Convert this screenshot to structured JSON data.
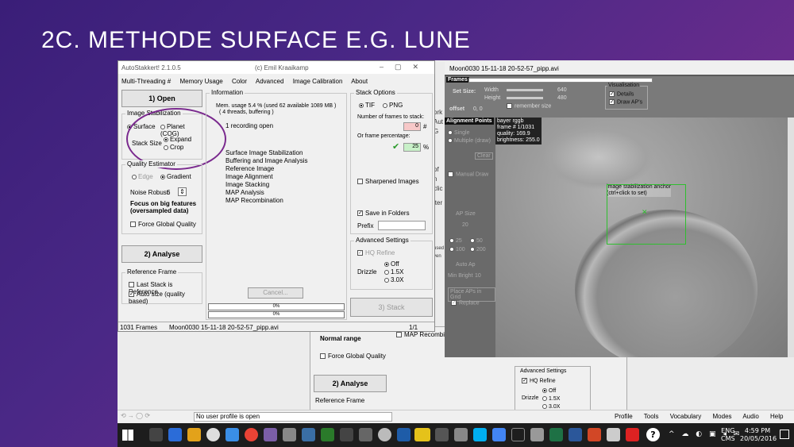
{
  "slide": {
    "title": "2C. METHODE SURFACE E.G. LUNE"
  },
  "main_window": {
    "title": "AutoStakkert! 2.1.0.5",
    "author": "(c) Emil Kraaikamp",
    "menu": [
      "Multi-Threading #",
      "Memory Usage",
      "Color",
      "Advanced",
      "Image Calibration",
      "About"
    ],
    "open_button": "1) Open",
    "image_stabilization": {
      "label": "Image Stabilization",
      "surface": "Surface",
      "planet": "Planet (COG)",
      "stack_size": "Stack Size",
      "expand": "Expand",
      "crop": "Crop"
    },
    "quality_estimator": {
      "label": "Quality Estimator",
      "edge": "Edge",
      "gradient": "Gradient",
      "noise_robust": "Noise Robust",
      "noise_value": "6",
      "focus_text": "Focus on big features (oversampled data)",
      "force_global": "Force Global Quality"
    },
    "analyse_button": "2) Analyse",
    "reference_frame": {
      "label": "Reference Frame",
      "last_stack": "Last Stack is Reference",
      "auto_size": "Auto size (quality based)"
    },
    "information": {
      "label": "Information",
      "mem_line1": "Mem. usage 5.4 %  (used 62 available 1089 MB )",
      "mem_line2": "( 4 threads, buffering )",
      "status": "1 recording open",
      "steps": [
        "Surface Image Stabilization",
        "Buffering and Image Analysis",
        "Reference Image",
        "Image Alignment",
        "Image Stacking",
        "MAP Analysis",
        "MAP Recombination"
      ]
    },
    "cancel_button": "Cancel...",
    "progress1": "0%",
    "progress2": "0%",
    "stack_options": {
      "label": "Stack Options",
      "tif": "TIF",
      "png": "PNG",
      "num_frames_label": "Number of frames to stack:",
      "num_frames_value": "0",
      "hash": "#",
      "percentage_label": "Or frame percentage:",
      "percentage_value": "25",
      "percent": "%",
      "sharpened": "Sharpened Images",
      "save_folders": "Save in Folders",
      "prefix": "Prefix"
    },
    "advanced": {
      "label": "Advanced Settings",
      "hq_refine": "HQ Refine",
      "drizzle": "Drizzle",
      "off": "Off",
      "d15": "1.5X",
      "d30": "3.0X"
    },
    "stack_button": "3) Stack",
    "status_bar": {
      "frames": "1031 Frames",
      "file": "Moon0030 15-11-18 20-52-57_pipp.avi",
      "page": "1/1"
    }
  },
  "preview_window": {
    "title": "Moon0030 15-11-18 20-52-57_pipp.avi",
    "frames_label": "Frames",
    "set_size": "Set Size:",
    "width_label": "Width",
    "width_value": "640",
    "height_label": "Height",
    "height_value": "480",
    "remember": "remember size",
    "offset": "offset",
    "offset_value": "0, 0",
    "visualisation": {
      "label": "Visualisation",
      "details": "Details",
      "draw_aps": "Draw AP's"
    },
    "alignment_points": "Alignment Points",
    "info_overlay": [
      "bayer rggb",
      "frame # 1/1031",
      "quality: 169.9",
      "brightness: 255.0"
    ],
    "anchor_text": "image stabilization anchor",
    "anchor_hint": "(ctrl+click to set)",
    "side_labels": {
      "single": "Single",
      "multiple": "Multiple (draw)",
      "clear": "Clear",
      "manual": "Manual Draw",
      "ap_size": "AP Size",
      "ap_size_val": "20",
      "s25": "25",
      "s50": "50",
      "s100": "100",
      "s200": "200",
      "auto_ap": "Auto Ap",
      "min_bright": "Min Bright",
      "min_bright_val": "10",
      "place_grid": "Place APs in Grid",
      "replace": "Replace"
    }
  },
  "back_window": {
    "normal_range": "Normal range",
    "force_global": "Force Global Quality",
    "analyse": "2) Analyse",
    "ref_frame": "Reference Frame",
    "map_recomb": "MAP Recombinat",
    "advanced": "Advanced Settings",
    "hq_refine": "HQ Refine",
    "drizzle": "Drizzle",
    "off": "Off",
    "d15": "1.5X",
    "d30": "3.0X",
    "frag_ork": "ork",
    "frag_aut": "Aut",
    "frag_g": "G",
    "frag_of": "of",
    "frag_n": "n",
    "frag_clic": "clic",
    "frag_iter": "iter",
    "frag_used": "used",
    "frag_ven": "ven"
  },
  "bottom_bar": {
    "profile_status": "No user profile is open",
    "menu": [
      "Profile",
      "Tools",
      "Vocabulary",
      "Modes",
      "Audio",
      "Help"
    ]
  },
  "taskbar": {
    "time": "4:59 PM",
    "date": "20/05/2016",
    "lang1": "ENG",
    "lang2": "CMS"
  }
}
